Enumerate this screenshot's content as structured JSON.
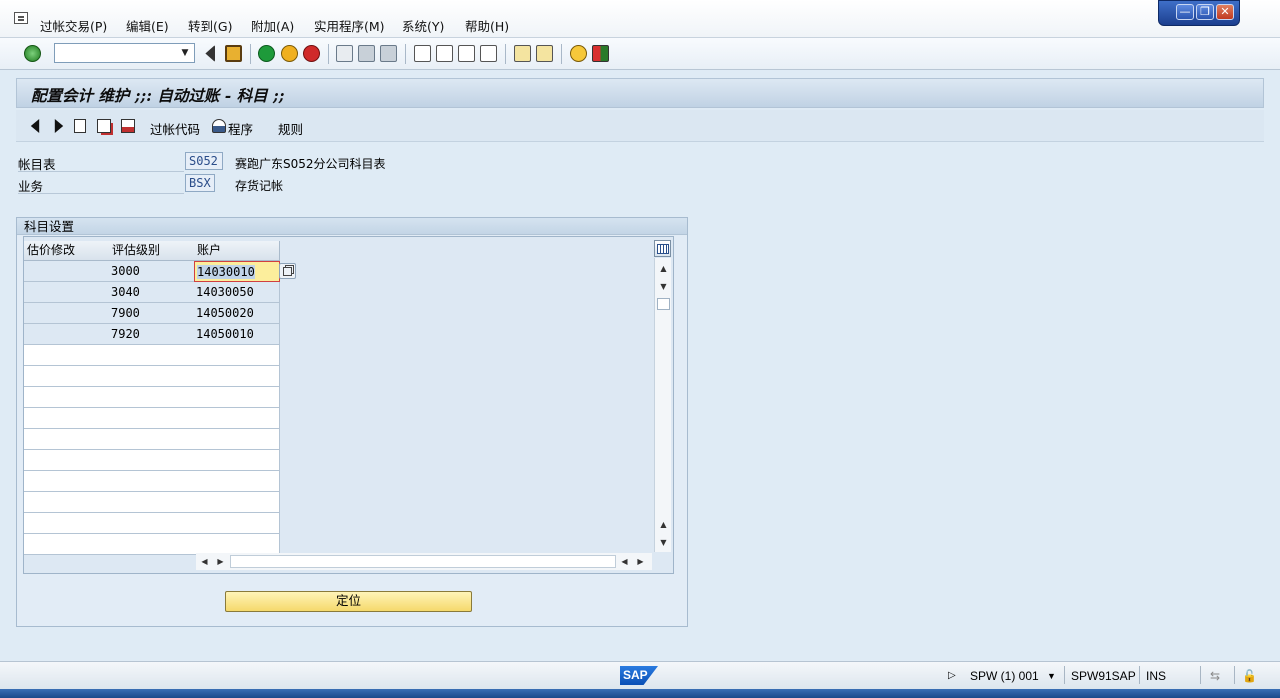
{
  "menu": {
    "items": [
      "过帐交易(P)",
      "编辑(E)",
      "转到(G)",
      "附加(A)",
      "实用程序(M)",
      "系统(Y)",
      "帮助(H)"
    ]
  },
  "window": {
    "minimize": "—",
    "restore": "❐",
    "close": "✕"
  },
  "command_field": {
    "value": ""
  },
  "title": "配置会计 维护 ;;: 自动过账 - 科目 ;;",
  "app_toolbar": {
    "posting_code": "过帐代码",
    "procedure": "程序",
    "rules": "规则"
  },
  "header": {
    "chart_of_accounts": {
      "label": "帐目表",
      "value": "S052",
      "description": "赛跑广东S052分公司科目表"
    },
    "transaction": {
      "label": "业务",
      "value": "BSX",
      "description": "存货记帐"
    }
  },
  "group": {
    "title": "科目设置"
  },
  "table": {
    "columns": [
      "估价修改",
      "评估级别",
      "账户"
    ],
    "rows": [
      [
        "",
        "3000",
        "14030010"
      ],
      [
        "",
        "3040",
        "14030050"
      ],
      [
        "",
        "7900",
        "14050020"
      ],
      [
        "",
        "7920",
        "14050010"
      ]
    ]
  },
  "position_button": "定位",
  "status": {
    "logo": "SAP",
    "system": "SPW (1) 001",
    "server": "SPW91SAP",
    "mode": "INS"
  },
  "colors": {
    "background": "#dfebf5",
    "selected_cell": "#fcee9c",
    "button": "#f5d96c",
    "title_bar": "#c0d2e4"
  }
}
